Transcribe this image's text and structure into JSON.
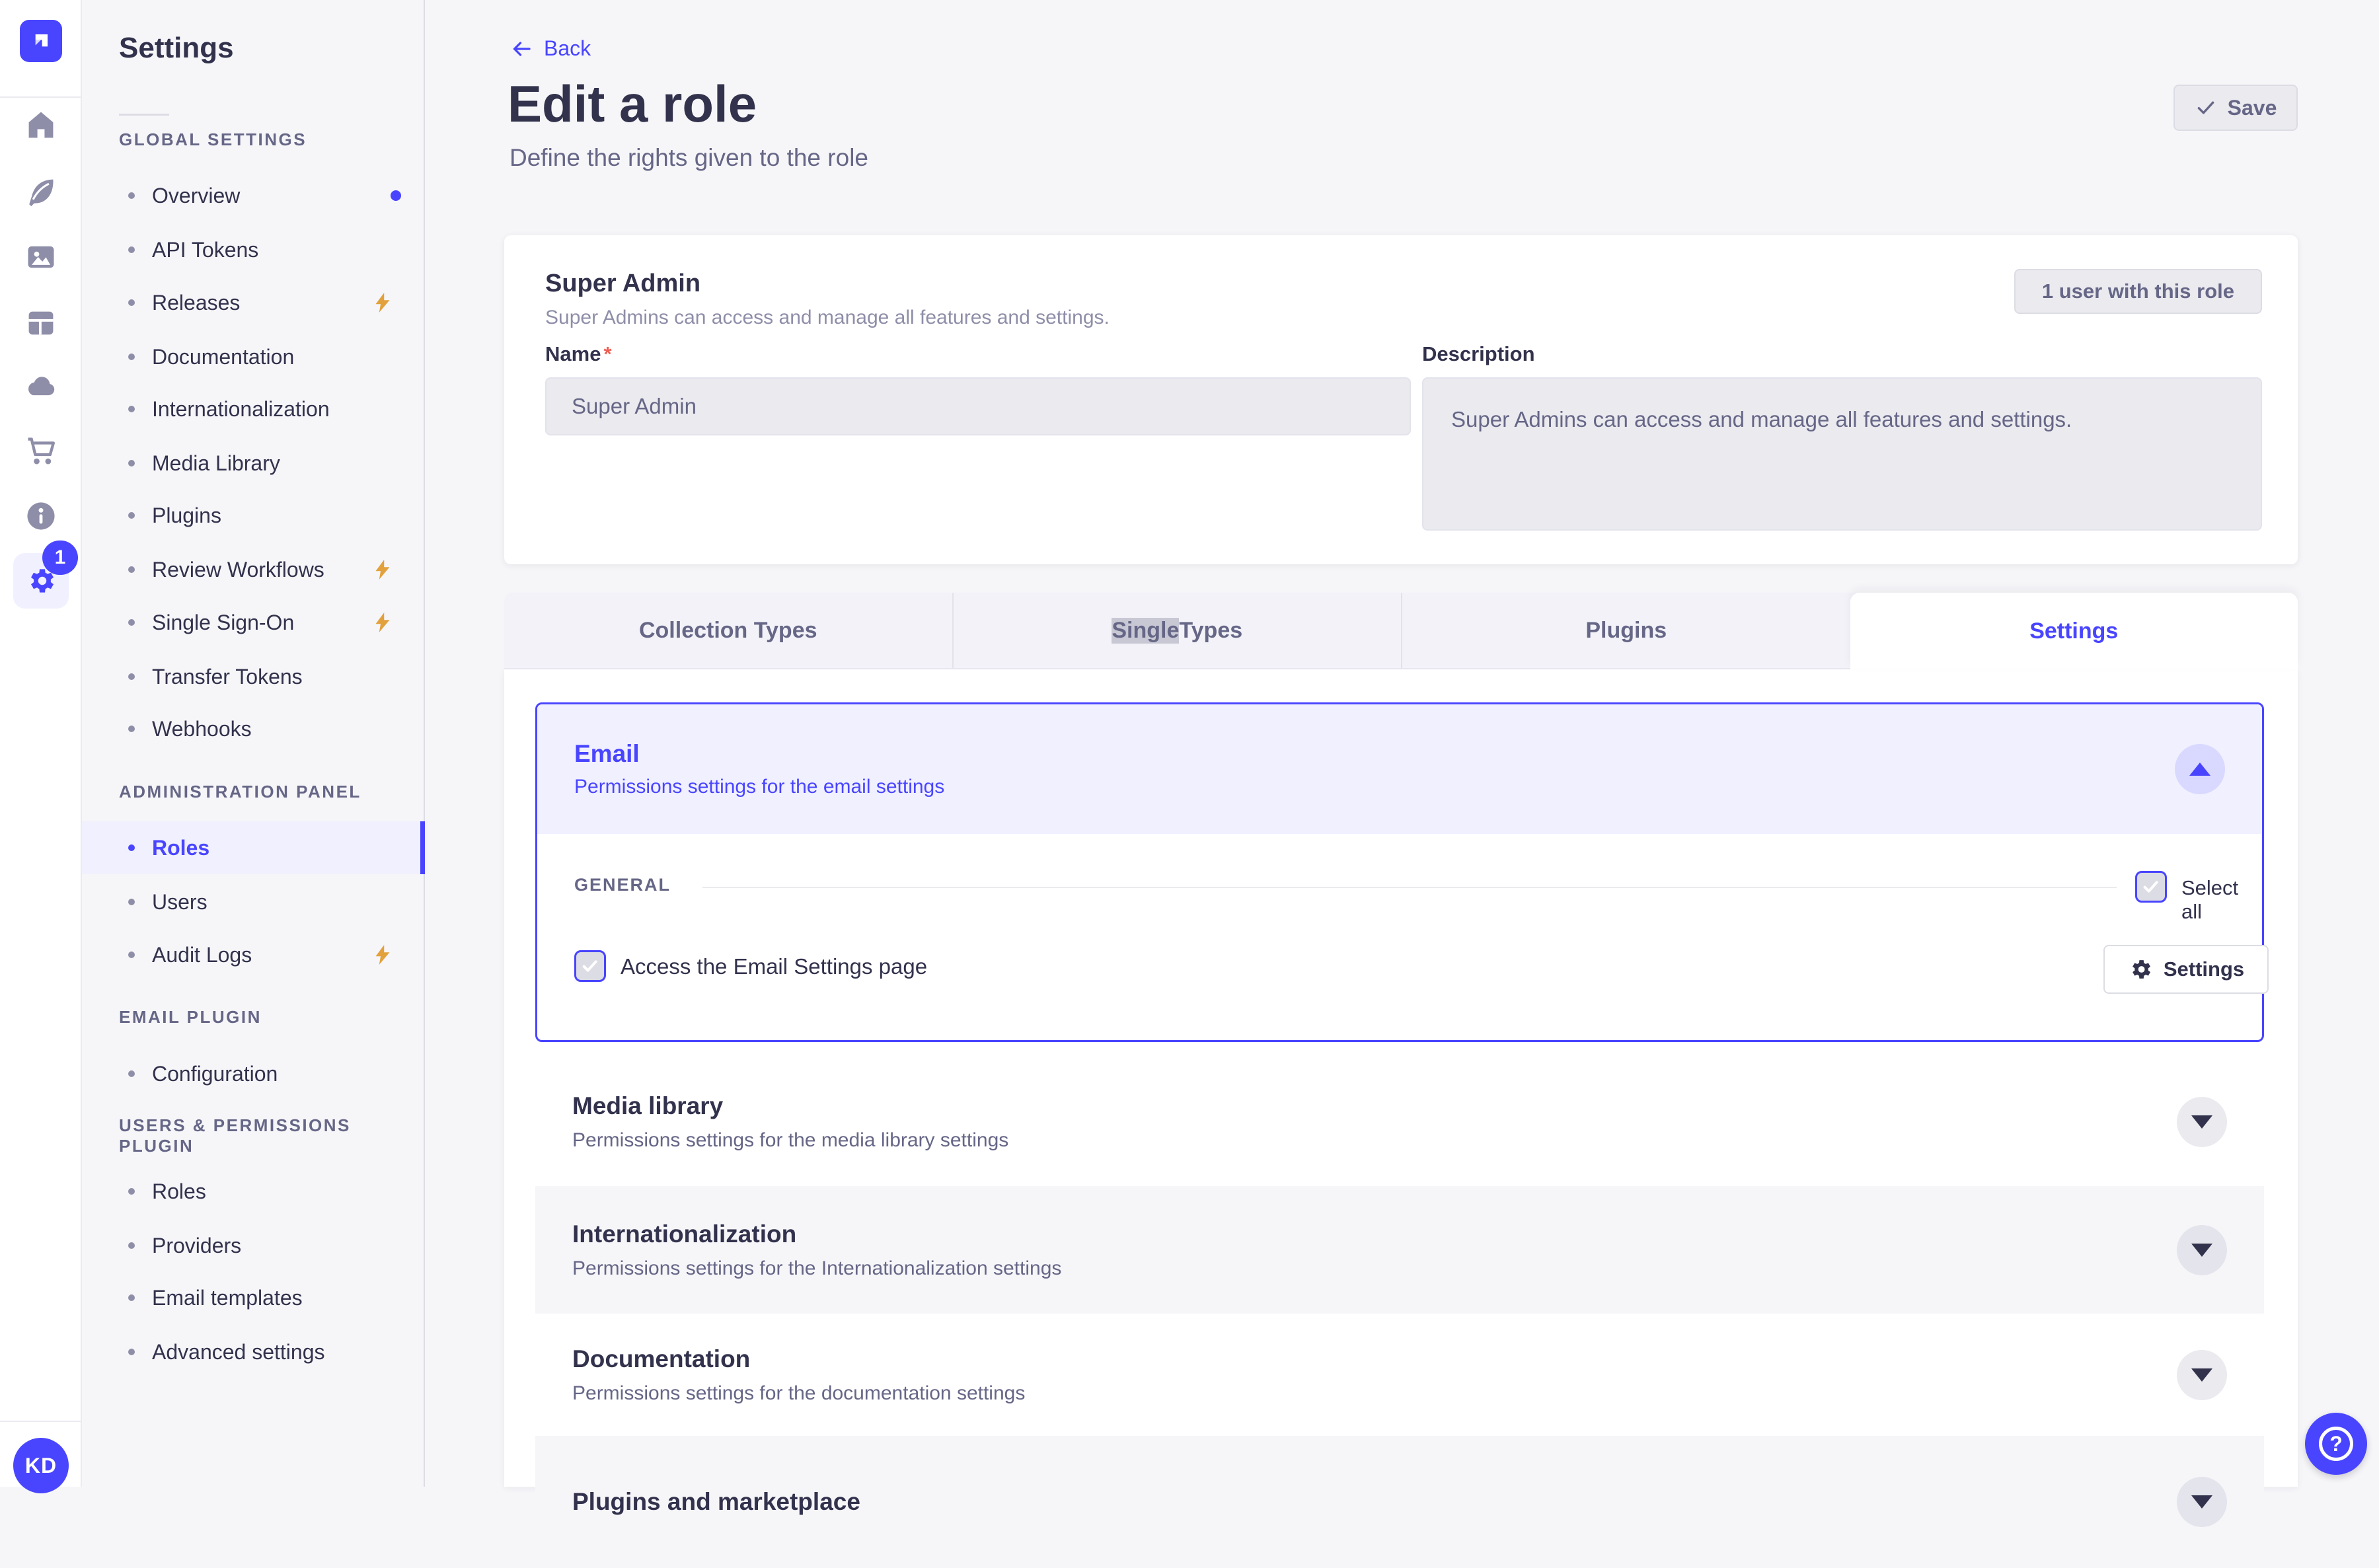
{
  "colors": {
    "primary": "#4945FF",
    "primary_light": "#F0F0FF",
    "primary_soft": "#D9D8FF",
    "text": "#32324D",
    "text_muted": "#666687",
    "border": "#DCDCE4",
    "page_bg": "#F6F6F9",
    "disabled_bg": "#EAEAEF",
    "bolt_orange": "#E2A13D",
    "required_red": "#EE5E52"
  },
  "rail": {
    "badge": "1",
    "avatar_initials": "KD",
    "icons": [
      "home",
      "content-type-builder",
      "media-library",
      "content-manager",
      "cloud",
      "marketplace",
      "info",
      "settings"
    ]
  },
  "sidebar": {
    "title": "Settings",
    "groups": [
      {
        "label": "GLOBAL SETTINGS",
        "items": [
          {
            "label": "Overview"
          },
          {
            "label": "API Tokens"
          },
          {
            "label": "Releases"
          },
          {
            "label": "Documentation"
          },
          {
            "label": "Internationalization"
          },
          {
            "label": "Media Library"
          },
          {
            "label": "Plugins"
          },
          {
            "label": "Review Workflows"
          },
          {
            "label": "Single Sign-On"
          },
          {
            "label": "Transfer Tokens"
          },
          {
            "label": "Webhooks"
          }
        ]
      },
      {
        "label": "ADMINISTRATION PANEL",
        "items": [
          {
            "label": "Roles"
          },
          {
            "label": "Users"
          },
          {
            "label": "Audit Logs"
          }
        ]
      },
      {
        "label": "EMAIL PLUGIN",
        "items": [
          {
            "label": "Configuration"
          }
        ]
      },
      {
        "label": "USERS & PERMISSIONS PLUGIN",
        "items": [
          {
            "label": "Roles"
          },
          {
            "label": "Providers"
          },
          {
            "label": "Email templates"
          },
          {
            "label": "Advanced settings"
          }
        ]
      }
    ]
  },
  "header": {
    "back_label": "Back",
    "title": "Edit a role",
    "subtitle": "Define the rights given to the role",
    "save_label": "Save"
  },
  "role_card": {
    "title": "Super Admin",
    "description": "Super Admins can access and manage all features and settings.",
    "users_button": "1 user with this role",
    "name_label": "Name",
    "required_marker": "*",
    "name_value": "Super Admin",
    "description_label": "Description",
    "description_value": "Super Admins can access and manage all features and settings."
  },
  "tabs": {
    "items": [
      {
        "label": "Collection Types"
      },
      {
        "word_highlight": "Single",
        "word_rest": " Types"
      },
      {
        "label": "Plugins"
      },
      {
        "label": "Settings"
      }
    ],
    "active": "Settings"
  },
  "permissions": {
    "email": {
      "title": "Email",
      "subtitle": "Permissions settings for the email settings",
      "section_label": "GENERAL",
      "select_all_label": "Select all",
      "access_label": "Access the Email Settings page",
      "settings_button_label": "Settings",
      "select_all_checked": true,
      "access_checked": true
    },
    "accordions": [
      {
        "title": "Media library",
        "subtitle": "Permissions settings for the media library settings"
      },
      {
        "title": "Internationalization",
        "subtitle": "Permissions settings for the Internationalization settings"
      },
      {
        "title": "Documentation",
        "subtitle": "Permissions settings for the documentation settings"
      },
      {
        "title": "Plugins and marketplace"
      }
    ]
  },
  "help": {
    "glyph": "?"
  }
}
